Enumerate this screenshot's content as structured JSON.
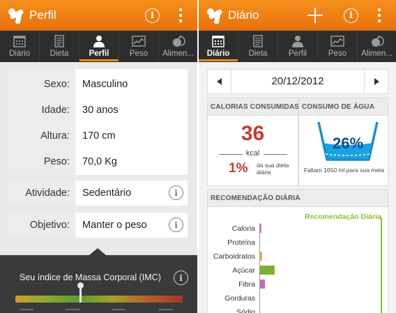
{
  "left": {
    "title": "Perfil",
    "tabs": [
      {
        "label": "Diário",
        "icon": "calendar-icon",
        "active": false
      },
      {
        "label": "Dieta",
        "icon": "notepad-icon",
        "active": false
      },
      {
        "label": "Perfil",
        "icon": "person-icon",
        "active": true
      },
      {
        "label": "Peso",
        "icon": "chart-icon",
        "active": false
      },
      {
        "label": "Alimen...",
        "icon": "food-icon",
        "active": false
      }
    ],
    "profile": {
      "sex_label": "Sexo:",
      "sex_value": "Masculino",
      "age_label": "Idade:",
      "age_value": "30 anos",
      "height_label": "Altura:",
      "height_value": "170 cm",
      "weight_label": "Peso:",
      "weight_value": "70,0 Kg"
    },
    "activity": {
      "label": "Atividade:",
      "value": "Sedentário"
    },
    "goal": {
      "label": "Objetivo:",
      "value": "Manter o peso"
    },
    "bmi": {
      "title": "Seu índice de Massa Corporal (IMC)",
      "marker_fraction": 0.39
    }
  },
  "right": {
    "title": "Diário",
    "tabs": [
      {
        "label": "Diário",
        "icon": "calendar-icon",
        "active": true
      },
      {
        "label": "Dieta",
        "icon": "notepad-icon",
        "active": false
      },
      {
        "label": "Perfil",
        "icon": "person-icon",
        "active": false
      },
      {
        "label": "Peso",
        "icon": "chart-icon",
        "active": false
      },
      {
        "label": "Alimen...",
        "icon": "food-icon",
        "active": false
      }
    ],
    "date": "20/12/2012",
    "calories": {
      "header": "CALORIAS CONSUMIDAS",
      "value": "36",
      "unit": "kcal",
      "percent": "1%",
      "caption": "da sua dieta diária"
    },
    "water": {
      "header": "CONSUMO DE ÁGUA",
      "percent": "26%",
      "caption": "Faltam 1650 ml para sua meta"
    },
    "recommendation": {
      "header": "RECOMENDAÇÃO DIÁRIA",
      "legend": "Recomendação Diária",
      "items": [
        {
          "label": "Caloria",
          "fraction": 0.01,
          "color": "#e07a8c"
        },
        {
          "label": "Proteína",
          "fraction": 0.0,
          "color": "#cccccc"
        },
        {
          "label": "Carboidratos",
          "fraction": 0.02,
          "color": "#e3b05a"
        },
        {
          "label": "Açúcar",
          "fraction": 0.12,
          "color": "#7bb031"
        },
        {
          "label": "Fibra",
          "fraction": 0.04,
          "color": "#c46ac8"
        },
        {
          "label": "Gorduras",
          "fraction": 0.0,
          "color": "#cccccc"
        },
        {
          "label": "Sódio",
          "fraction": 0.0,
          "color": "#cccccc"
        }
      ]
    }
  },
  "colors": {
    "accent": "#f08a18",
    "tabbar": "#2d2d2d",
    "calorie_red": "#c43c2e",
    "water_blue": "#1aa3e0",
    "recommend_green": "#8cc031"
  }
}
